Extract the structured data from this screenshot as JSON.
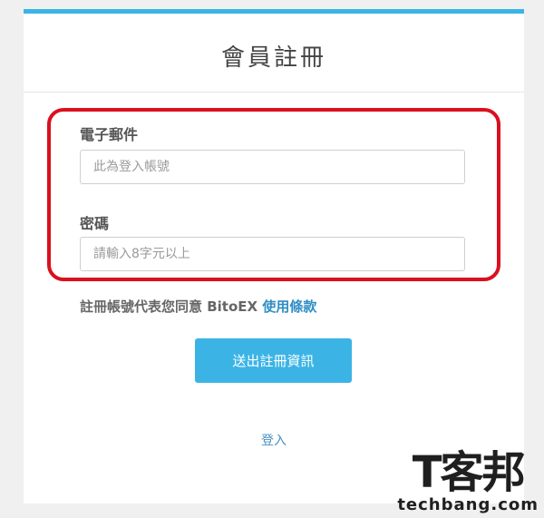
{
  "form": {
    "title": "會員註冊",
    "email_label": "電子郵件",
    "email_placeholder": "此為登入帳號",
    "password_label": "密碼",
    "password_placeholder": "請輸入8字元以上",
    "terms_prefix": "註冊帳號代表您同意 BitoEX ",
    "terms_link": "使用條款",
    "submit_label": "送出註冊資訊",
    "login_link": "登入"
  },
  "watermark": {
    "logo_text": "T客邦",
    "domain": "techbang.com"
  },
  "colors": {
    "accent": "#3bb4e5",
    "highlight": "#d9101f",
    "link": "#2f8ec4"
  }
}
